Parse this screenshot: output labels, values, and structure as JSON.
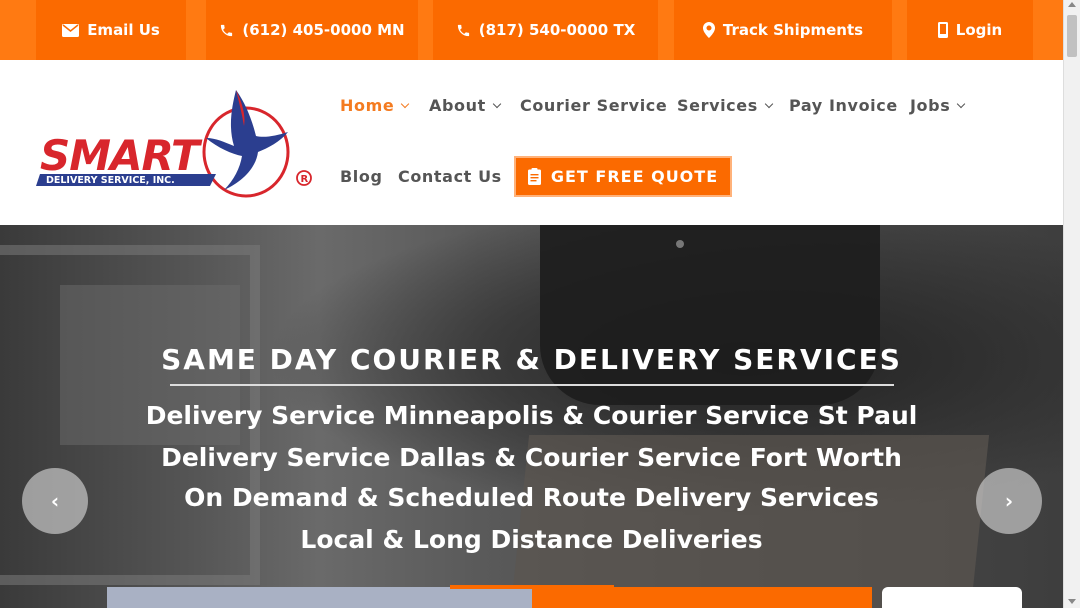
{
  "topbar": {
    "email": "Email Us",
    "phone_mn": "(612) 405-0000 MN",
    "phone_tx": "(817) 540-0000 TX",
    "track": "Track Shipments",
    "login": "Login"
  },
  "logo": {
    "brand": "SMART",
    "tagline": "DELIVERY SERVICE, INC.",
    "registered": "®"
  },
  "nav": {
    "items": [
      {
        "label": "Home",
        "dropdown": true,
        "active": true
      },
      {
        "label": "About",
        "dropdown": true
      },
      {
        "label": "Courier Service",
        "dropdown": false
      },
      {
        "label": "Services",
        "dropdown": true
      },
      {
        "label": "Pay Invoice",
        "dropdown": false
      },
      {
        "label": "Jobs",
        "dropdown": true
      },
      {
        "label": "Blog",
        "dropdown": false
      },
      {
        "label": "Contact Us",
        "dropdown": false
      }
    ],
    "cta": "GET FREE QUOTE"
  },
  "hero": {
    "title": "SAME DAY COURIER & DELIVERY SERVICES",
    "lines": [
      "Delivery Service Minneapolis & Courier Service St Paul",
      "Delivery Service Dallas & Courier Service Fort Worth",
      "On Demand & Scheduled Route Delivery Services",
      "Local & Long Distance Deliveries"
    ],
    "prev": "‹",
    "next": "›"
  },
  "colors": {
    "accent": "#fb6a00",
    "topbar_bg": "#ff7a12",
    "nav_text": "#555555",
    "nav_active": "#f47b20"
  }
}
